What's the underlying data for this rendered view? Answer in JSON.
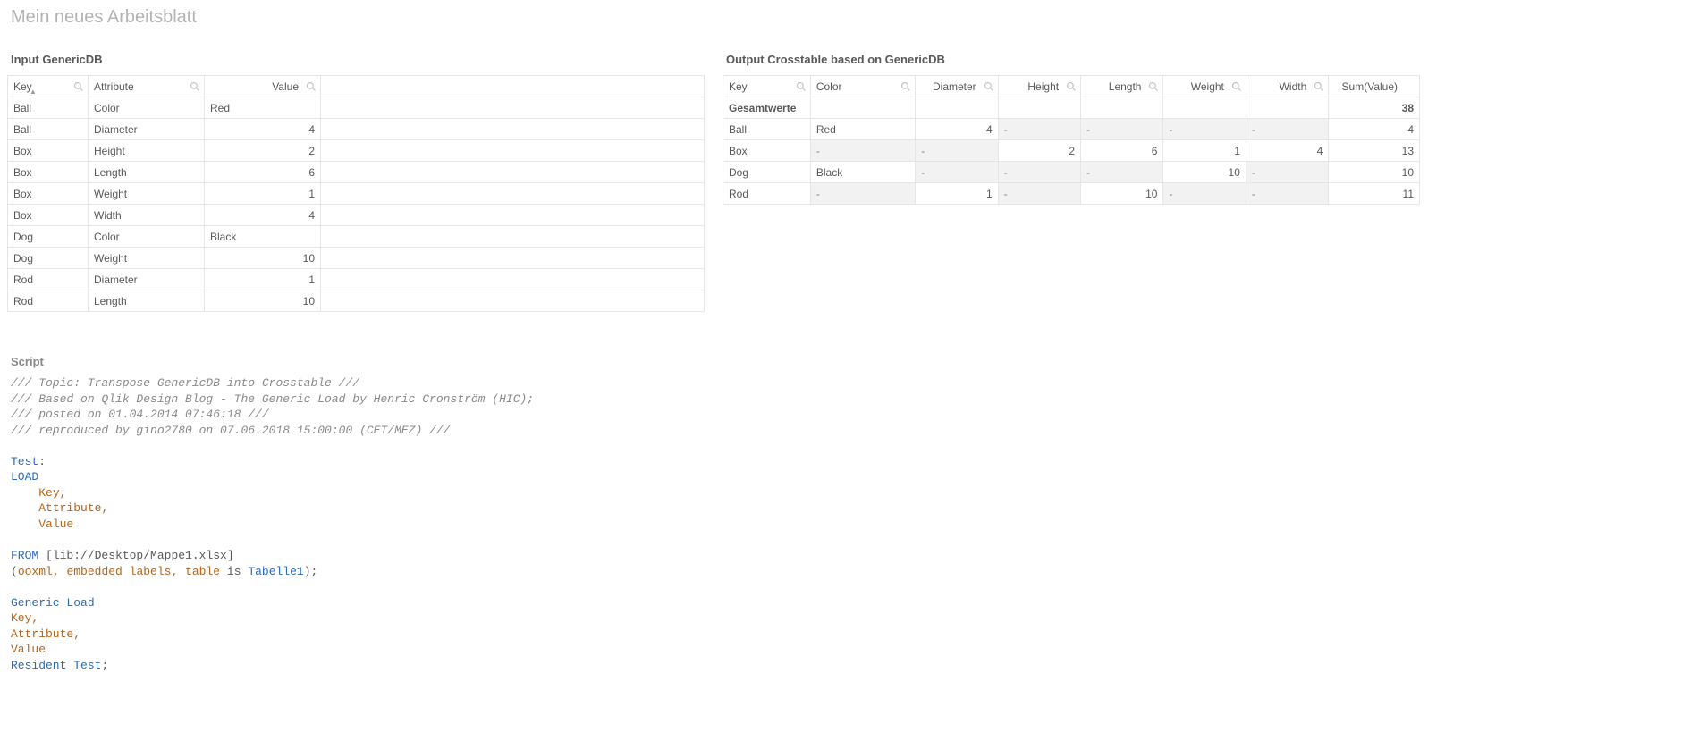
{
  "pageTitle": "Mein neues Arbeitsblatt",
  "input": {
    "title": "Input GenericDB",
    "columns": [
      "Key",
      "Attribute",
      "Value"
    ],
    "rows": [
      {
        "key": "Ball",
        "attr": "Color",
        "val": "Red",
        "num": false
      },
      {
        "key": "Ball",
        "attr": "Diameter",
        "val": "4",
        "num": true
      },
      {
        "key": "Box",
        "attr": "Height",
        "val": "2",
        "num": true
      },
      {
        "key": "Box",
        "attr": "Length",
        "val": "6",
        "num": true
      },
      {
        "key": "Box",
        "attr": "Weight",
        "val": "1",
        "num": true
      },
      {
        "key": "Box",
        "attr": "Width",
        "val": "4",
        "num": true
      },
      {
        "key": "Dog",
        "attr": "Color",
        "val": "Black",
        "num": false
      },
      {
        "key": "Dog",
        "attr": "Weight",
        "val": "10",
        "num": true
      },
      {
        "key": "Rod",
        "attr": "Diameter",
        "val": "1",
        "num": true
      },
      {
        "key": "Rod",
        "attr": "Length",
        "val": "10",
        "num": true
      }
    ]
  },
  "output": {
    "title": "Output Crosstable based on GenericDB",
    "columns": [
      "Key",
      "Color",
      "Diameter",
      "Height",
      "Length",
      "Weight",
      "Width",
      "Sum(Value)"
    ],
    "totalsLabel": "Gesamtwerte",
    "totalSum": "38",
    "rows": [
      {
        "key": "Ball",
        "color": "Red",
        "diameter": "4",
        "height": "-",
        "length": "-",
        "weight": "-",
        "width": "-",
        "sum": "4"
      },
      {
        "key": "Box",
        "color": "-",
        "diameter": "-",
        "height": "2",
        "length": "6",
        "weight": "1",
        "width": "4",
        "sum": "13"
      },
      {
        "key": "Dog",
        "color": "Black",
        "diameter": "-",
        "height": "-",
        "length": "-",
        "weight": "10",
        "width": "-",
        "sum": "10"
      },
      {
        "key": "Rod",
        "color": "-",
        "diameter": "1",
        "height": "-",
        "length": "10",
        "weight": "-",
        "width": "-",
        "sum": "11"
      }
    ]
  },
  "script": {
    "title": "Script",
    "lines": [
      {
        "t": "comment",
        "text": "/// Topic: Transpose GenericDB into Crosstable ///"
      },
      {
        "t": "comment",
        "text": "/// Based on Qlik Design Blog - The Generic Load by Henric Cronström (HIC);"
      },
      {
        "t": "comment",
        "text": "/// posted on 01.04.2014 07:46:18 ///"
      },
      {
        "t": "comment",
        "text": "/// reproduced by gino2780 on 07.06.2018 15:00:00 (CET/MEZ) ///"
      },
      {
        "t": "blank"
      },
      {
        "t": "parts",
        "parts": [
          {
            "c": "kw",
            "s": "Test"
          },
          {
            "c": "text",
            "s": ":"
          }
        ]
      },
      {
        "t": "parts",
        "parts": [
          {
            "c": "kw",
            "s": "LOAD"
          }
        ]
      },
      {
        "t": "parts",
        "parts": [
          {
            "c": "text",
            "s": "    "
          },
          {
            "c": "id",
            "s": "Key"
          },
          {
            "c": "punct",
            "s": ","
          }
        ]
      },
      {
        "t": "parts",
        "parts": [
          {
            "c": "text",
            "s": "    "
          },
          {
            "c": "id",
            "s": "Attribute"
          },
          {
            "c": "punct",
            "s": ","
          }
        ]
      },
      {
        "t": "parts",
        "parts": [
          {
            "c": "text",
            "s": "    "
          },
          {
            "c": "id",
            "s": "Value"
          }
        ]
      },
      {
        "t": "blank"
      },
      {
        "t": "parts",
        "parts": [
          {
            "c": "kw",
            "s": "FROM"
          },
          {
            "c": "text",
            "s": " [lib://Desktop/Mappe1.xlsx]"
          }
        ]
      },
      {
        "t": "parts",
        "parts": [
          {
            "c": "text",
            "s": "("
          },
          {
            "c": "id",
            "s": "ooxml"
          },
          {
            "c": "punct",
            "s": ", "
          },
          {
            "c": "id",
            "s": "embedded labels"
          },
          {
            "c": "punct",
            "s": ", "
          },
          {
            "c": "id",
            "s": "table"
          },
          {
            "c": "text",
            "s": " is "
          },
          {
            "c": "kw",
            "s": "Tabelle1"
          },
          {
            "c": "text",
            "s": ");"
          }
        ]
      },
      {
        "t": "blank"
      },
      {
        "t": "parts",
        "parts": [
          {
            "c": "kw",
            "s": "Generic Load"
          }
        ]
      },
      {
        "t": "parts",
        "parts": [
          {
            "c": "id",
            "s": "Key"
          },
          {
            "c": "punct",
            "s": ","
          }
        ]
      },
      {
        "t": "parts",
        "parts": [
          {
            "c": "id",
            "s": "Attribute"
          },
          {
            "c": "punct",
            "s": ","
          }
        ]
      },
      {
        "t": "parts",
        "parts": [
          {
            "c": "id",
            "s": "Value"
          }
        ]
      },
      {
        "t": "parts",
        "parts": [
          {
            "c": "kw",
            "s": "Resident"
          },
          {
            "c": "text",
            "s": " "
          },
          {
            "c": "kw",
            "s": "Test"
          },
          {
            "c": "text",
            "s": ";"
          }
        ]
      }
    ]
  }
}
